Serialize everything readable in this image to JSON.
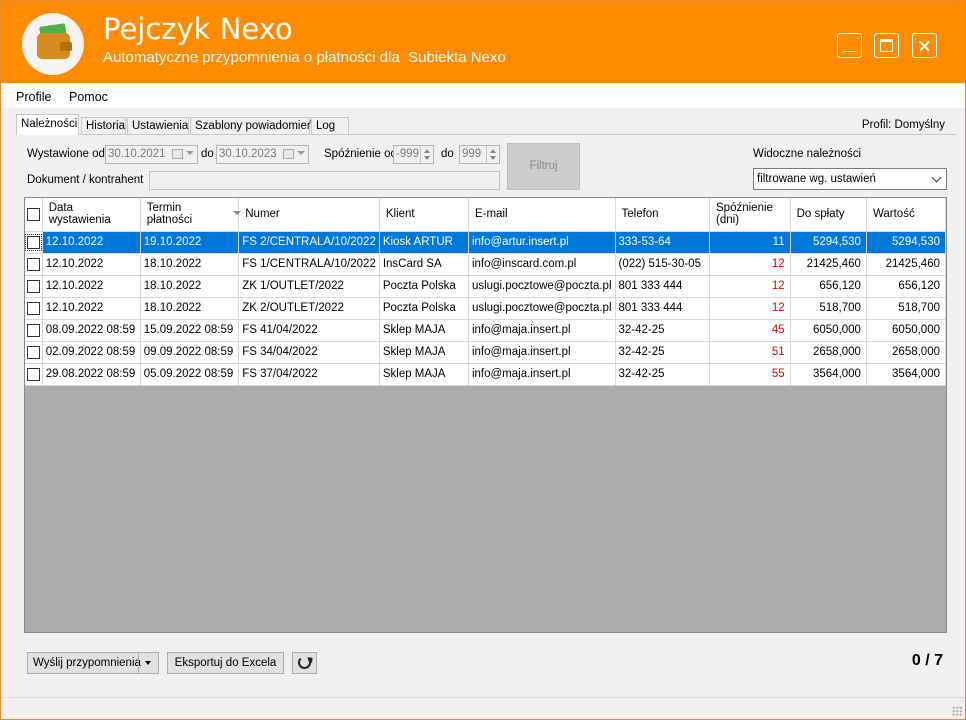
{
  "app": {
    "title": "Pejczyk Nexo",
    "subtitle": "Automatyczne przypomnienia o płatności dla  Subiekta Nexo"
  },
  "menu": [
    "Profile",
    "Pomoc"
  ],
  "tabs": [
    "Należności",
    "Historia",
    "Ustawienia",
    "Szablony powiadomień",
    "Log"
  ],
  "profile_label": "Profil: Domyślny",
  "filters": {
    "issued_label": "Wystawione od",
    "issued_from": "30.10.2021",
    "to_label": "do",
    "issued_to": "30.10.2023",
    "delay_label": "Spóźnienie od",
    "delay_from": "-999",
    "delay_to_label": "do",
    "delay_to": "999",
    "filter_button": "Filtruj",
    "doc_label": "Dokument / kontrahent",
    "doc_value": "",
    "visible_label": "Widoczne należności",
    "visible_value": "filtrowane wg. ustawień"
  },
  "table": {
    "headers": {
      "date": "Data\nwystawienia",
      "due": "Termin\npłatności",
      "number": "Numer",
      "client": "Klient",
      "email": "E-mail",
      "phone": "Telefon",
      "delay": "Spóźnienie\n(dni)",
      "to_pay": "Do spłaty",
      "value": "Wartość"
    },
    "rows": [
      {
        "date": "12.10.2022",
        "due": "19.10.2022",
        "number": "FS 2/CENTRALA/10/2022",
        "client": "Kiosk ARTUR",
        "email": "info@artur.insert.pl",
        "phone": "333-53-64",
        "delay": "11",
        "to_pay": "5294,530",
        "value": "5294,530"
      },
      {
        "date": "12.10.2022",
        "due": "18.10.2022",
        "number": "FS 1/CENTRALA/10/2022",
        "client": "InsCard SA",
        "email": "info@inscard.com.pl",
        "phone": "(022) 515-30-05",
        "delay": "12",
        "to_pay": "21425,460",
        "value": "21425,460"
      },
      {
        "date": "12.10.2022",
        "due": "18.10.2022",
        "number": "ZK 1/OUTLET/2022",
        "client": "Poczta Polska",
        "email": "uslugi.pocztowe@poczta.pl",
        "phone": "801 333 444",
        "delay": "12",
        "to_pay": "656,120",
        "value": "656,120"
      },
      {
        "date": "12.10.2022",
        "due": "18.10.2022",
        "number": "ZK 2/OUTLET/2022",
        "client": "Poczta Polska",
        "email": "uslugi.pocztowe@poczta.pl",
        "phone": "801 333 444",
        "delay": "12",
        "to_pay": "518,700",
        "value": "518,700"
      },
      {
        "date": "08.09.2022 08:59",
        "due": "15.09.2022 08:59",
        "number": "FS 41/04/2022",
        "client": "Sklep MAJA",
        "email": "info@maja.insert.pl",
        "phone": "32-42-25",
        "delay": "45",
        "to_pay": "6050,000",
        "value": "6050,000"
      },
      {
        "date": "02.09.2022 08:59",
        "due": "09.09.2022 08:59",
        "number": "FS 34/04/2022",
        "client": "Sklep MAJA",
        "email": "info@maja.insert.pl",
        "phone": "32-42-25",
        "delay": "51",
        "to_pay": "2658,000",
        "value": "2658,000"
      },
      {
        "date": "29.08.2022 08:59",
        "due": "05.09.2022 08:59",
        "number": "FS 37/04/2022",
        "client": "Sklep MAJA",
        "email": "info@maja.insert.pl",
        "phone": "32-42-25",
        "delay": "55",
        "to_pay": "3564,000",
        "value": "3564,000"
      }
    ]
  },
  "bottom": {
    "send_button": "Wyślij przypomnienia",
    "export_button": "Eksportuj do Excela",
    "counter": "0 / 7"
  },
  "colors": {
    "header_bg": "#ff8c00",
    "selection": "#0078d7",
    "overdue_text": "#e00000"
  }
}
